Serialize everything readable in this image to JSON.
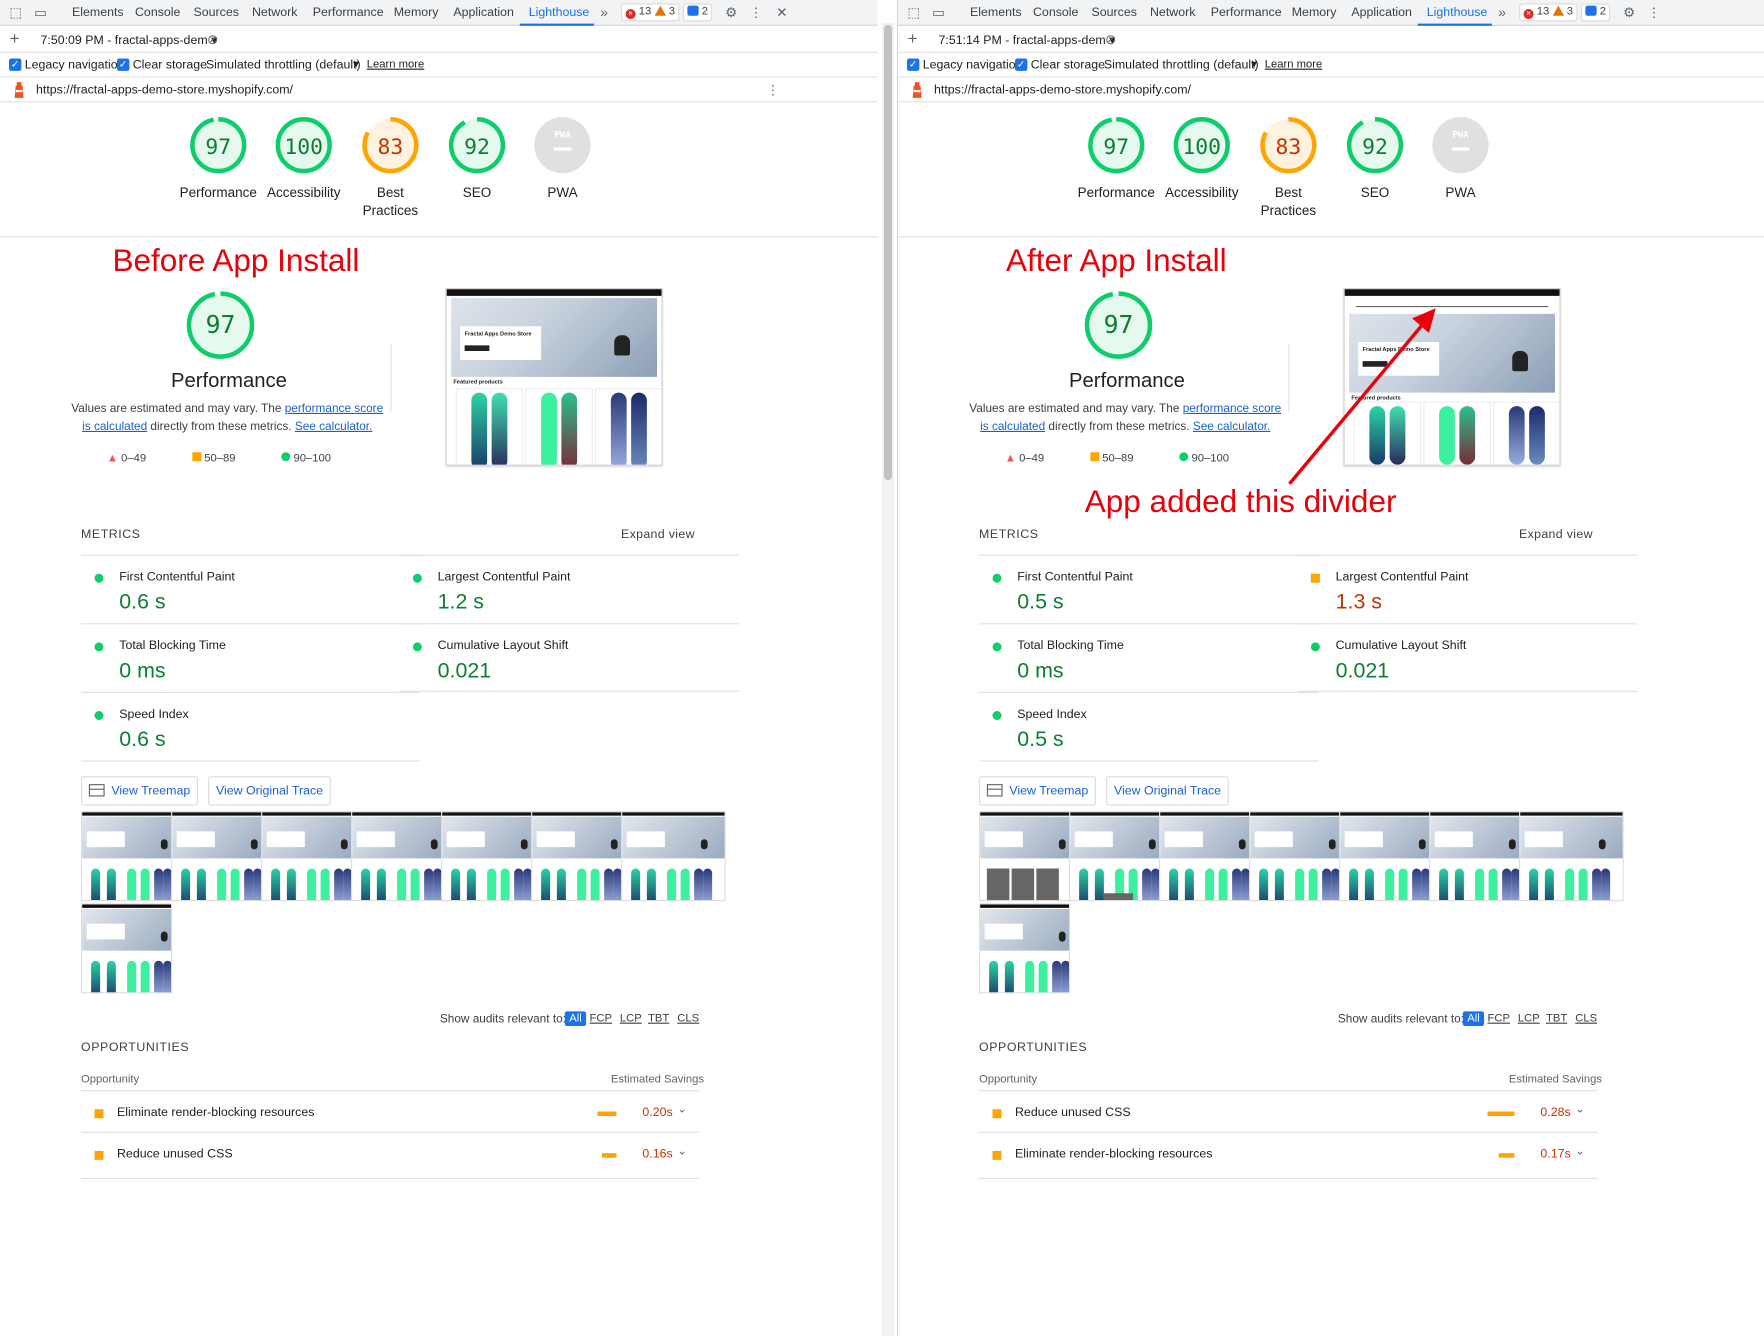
{
  "tabs": [
    "Elements",
    "Console",
    "Sources",
    "Network",
    "Performance",
    "Memory",
    "Application",
    "Lighthouse"
  ],
  "badges": {
    "errors": "13",
    "warnings": "3",
    "messages": "2"
  },
  "toolbar3": {
    "legacy": "Legacy navigation",
    "clear": "Clear storage",
    "throttle": "Simulated throttling (default)",
    "learn": "Learn more"
  },
  "url": "https://fractal-apps-demo-store.myshopify.com/",
  "categories": [
    "Performance",
    "Accessibility",
    "Best Practices",
    "SEO",
    "PWA"
  ],
  "perf": {
    "title": "Performance",
    "desc_a": "Values are estimated and may vary. The",
    "link1a": "performance score",
    "link1b": "is calculated",
    "desc_b": "directly from these metrics.",
    "link2": "See calculator.",
    "legend_red": "0–49",
    "legend_orange": "50–89",
    "legend_green": "90–100"
  },
  "metrics_title": "METRICS",
  "expand_view": "Expand view",
  "metric_names": [
    "First Contentful Paint",
    "Largest Contentful Paint",
    "Total Blocking Time",
    "Cumulative Layout Shift",
    "Speed Index"
  ],
  "buttons": {
    "treemap": "View Treemap",
    "trace": "View Original Trace"
  },
  "show_audits": "Show audits relevant to:",
  "filters": [
    "All",
    "FCP",
    "LCP",
    "TBT",
    "CLS"
  ],
  "opportunities": {
    "title": "OPPORTUNITIES",
    "col1": "Opportunity",
    "col2": "Estimated Savings"
  },
  "shot": {
    "store_name": "Fractal Apps Demo Store",
    "featured": "Featured products"
  },
  "colors": {
    "pass": "#0cce6b",
    "average": "#ffa400",
    "fail": "#ff4e42",
    "annotation": "#e8000b",
    "accent": "#1a73e8"
  },
  "left": {
    "timestamp": "7:50:09 PM - fractal-apps-dem",
    "annotation": "Before App Install",
    "scores": [
      "97",
      "100",
      "83",
      "92",
      "PWA"
    ],
    "score_values": [
      97,
      100,
      83,
      92
    ],
    "perf_score": "97",
    "perf_score_value": 97,
    "metric_values": [
      "0.6 s",
      "1.2 s",
      "0 ms",
      "0.021",
      "0.6 s"
    ],
    "opps": [
      {
        "name": "Eliminate render-blocking resources",
        "value": "0.20s"
      },
      {
        "name": "Reduce unused CSS",
        "value": "0.16s"
      }
    ]
  },
  "right": {
    "timestamp": "7:51:14 PM - fractal-apps-dem",
    "annotation": "After App Install",
    "arrow_note": "App added this divider",
    "scores": [
      "97",
      "100",
      "83",
      "92",
      "PWA"
    ],
    "score_values": [
      97,
      100,
      83,
      92
    ],
    "perf_score": "97",
    "perf_score_value": 97,
    "metric_values": [
      "0.5 s",
      "1.3 s",
      "0 ms",
      "0.021",
      "0.5 s"
    ],
    "opps": [
      {
        "name": "Reduce unused CSS",
        "value": "0.28s"
      },
      {
        "name": "Eliminate render-blocking resources",
        "value": "0.17s"
      }
    ]
  }
}
